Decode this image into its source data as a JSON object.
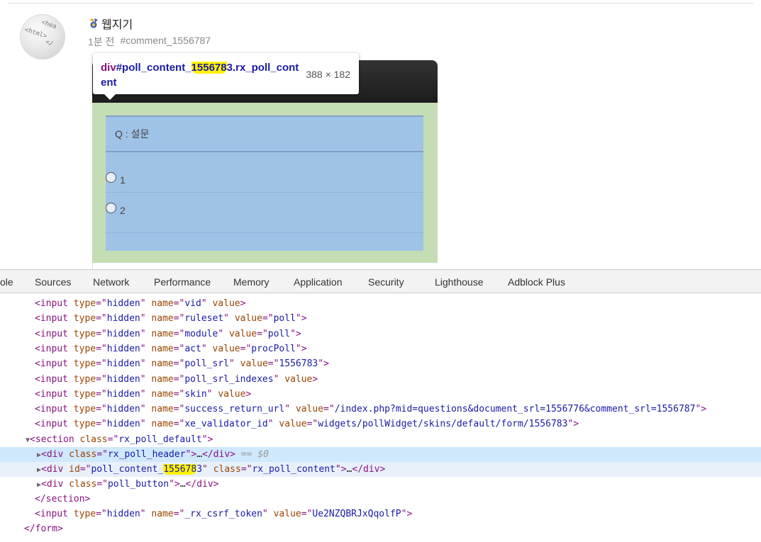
{
  "comment": {
    "author": "웹지기",
    "time": "1분 전",
    "permalink": "#comment_1556787"
  },
  "poll": {
    "question": "Q : 설문",
    "options": [
      "1",
      "2"
    ]
  },
  "tooltip": {
    "tag": "div",
    "selector_before": "#poll_content_",
    "selector_highlight": "155678",
    "selector_after": "3.rx_poll_content",
    "size": "388 × 182"
  },
  "devtools": {
    "tabs": [
      "ole",
      "Sources",
      "Network",
      "Performance",
      "Memory",
      "Application",
      "Security",
      "Lighthouse",
      "Adblock Plus"
    ],
    "lines": [
      {
        "type": "input",
        "name": "vid",
        "value": null
      },
      {
        "type": "input",
        "name": "ruleset",
        "value": "poll"
      },
      {
        "type": "input",
        "name": "module",
        "value": "poll"
      },
      {
        "type": "input",
        "name": "act",
        "value": "procPoll"
      },
      {
        "type": "input",
        "name": "poll_srl",
        "value": "1556783"
      },
      {
        "type": "input",
        "name": "poll_srl_indexes",
        "value": null
      },
      {
        "type": "input",
        "name": "skin",
        "value": null
      },
      {
        "type": "input",
        "name": "success_return_url",
        "value": "/index.php?mid=questions&document_srl=1556776&comment_srl=1556787"
      },
      {
        "type": "input",
        "name": "xe_validator_id",
        "value": "widgets/pollWidget/skins/default/form/1556783"
      }
    ],
    "section_class": "rx_poll_default",
    "header_class": "rx_poll_header",
    "selected_marker": "== $0",
    "content_id_before": "poll_content_",
    "content_id_highlight": "155678",
    "content_id_after": "3",
    "content_class": "rx_poll_content",
    "button_class": "poll_button",
    "csrf_name": "_rx_csrf_token",
    "csrf_value": "Ue2NZQBRJxQqolfP"
  }
}
